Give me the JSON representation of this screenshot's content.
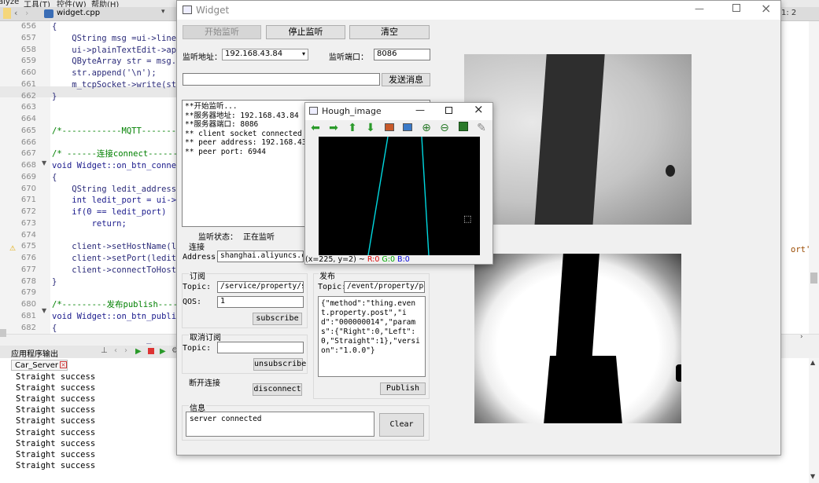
{
  "ide": {
    "menu": [
      "alyze",
      "工具(T)",
      "控件(W)",
      "帮助(H)"
    ],
    "tab_filename": "widget.cpp",
    "cursor_pos": "1: 2",
    "right_code_fragment": "ort')",
    "lines": [
      {
        "num": "656",
        "code": "{"
      },
      {
        "num": "657",
        "code": "    QString msg =ui->line"
      },
      {
        "num": "658",
        "code": "    ui->plainTextEdit->ap"
      },
      {
        "num": "659",
        "code": "    QByteArray str = msg."
      },
      {
        "num": "660",
        "code": "    str.append('\\n');"
      },
      {
        "num": "661",
        "code": "    m_tcpSocket->write(st"
      },
      {
        "num": "662",
        "code": "}"
      },
      {
        "num": "663",
        "code": ""
      },
      {
        "num": "664",
        "code": ""
      },
      {
        "num": "665",
        "code": "/*------------MQTT--------"
      },
      {
        "num": "666",
        "code": ""
      },
      {
        "num": "667",
        "code": "/* ------连接connect------"
      },
      {
        "num": "668",
        "code": "void Widget::on_btn_conne"
      },
      {
        "num": "669",
        "code": "{"
      },
      {
        "num": "670",
        "code": "    QString ledit_address"
      },
      {
        "num": "671",
        "code": "    int ledit_port = ui->"
      },
      {
        "num": "672",
        "code": "    if(0 == ledit_port)"
      },
      {
        "num": "673",
        "code": "        return;"
      },
      {
        "num": "674",
        "code": ""
      },
      {
        "num": "675",
        "code": "    client->setHostName(l"
      },
      {
        "num": "676",
        "code": "    client->setPort(ledit"
      },
      {
        "num": "677",
        "code": "    client->connectToHost"
      },
      {
        "num": "678",
        "code": "}"
      },
      {
        "num": "679",
        "code": ""
      },
      {
        "num": "680",
        "code": "/*---------发布publish----"
      },
      {
        "num": "681",
        "code": "void Widget::on_btn_publi"
      },
      {
        "num": "682",
        "code": "{"
      },
      {
        "num": "683",
        "code": "    // QByteArray m_paylo"
      }
    ],
    "output_title": "应用程序输出",
    "output_tab": "Car_Server",
    "output_lines": [
      "Straight success",
      "Straight success",
      "Straight success",
      "Straight success",
      "Straight success",
      "Straight success",
      "Straight success",
      "Straight success",
      "Straight success"
    ]
  },
  "widget": {
    "title": "Widget",
    "btn_start": "开始监听",
    "btn_stop": "停止监听",
    "btn_clear_top": "清空",
    "listen_addr_label": "监听地址：",
    "listen_addr_value": "192.168.43.84",
    "listen_port_label": "监听端口：",
    "listen_port_value": "8086",
    "send_input": "",
    "btn_send": "发送消息",
    "log_lines": [
      "**开始监听...",
      "**服务器地址: 192.168.43.84",
      "**服务器端口: 8086",
      "** client socket connected",
      "** peer address: 192.168.43.16",
      "** peer port: 6944"
    ],
    "status_label": "监听状态：",
    "status_value": "正在监听",
    "connect_group": "连接",
    "address_label": "Address:",
    "address_value": "shanghai.aliyuncs.com",
    "subscribe_group": "订阅",
    "topic_label": "Topic:",
    "sub_topic_value": "/service/property/set",
    "qos_label": "QOS:",
    "qos_value": "1",
    "btn_subscribe": "subscribe",
    "unsub_group": "取消订阅",
    "unsub_topic_value": "",
    "btn_unsubscribe": "unsubscribe",
    "disconnect_group": "断开连接",
    "btn_disconnect": "disconnect",
    "publish_group": "发布",
    "pub_topic_value": "/event/property/post",
    "pub_payload": "{\"method\":\"thing.event.property.post\",\"id\":\"000000014\",\"params\":{\"Right\":0,\"Left\":0,\"Straight\":1},\"version\":\"1.0.0\"}",
    "btn_publish": "Publish",
    "info_group": "信息",
    "info_text": "server connected",
    "btn_clear": "Clear"
  },
  "hough": {
    "title": "Hough_image",
    "toolbar_icons": [
      "arrow-left-icon",
      "arrow-right-icon",
      "arrow-up-icon",
      "arrow-down-icon",
      "image-icon",
      "image-save-icon",
      "zoom-in-icon",
      "zoom-out-icon",
      "save-icon",
      "brush-icon"
    ],
    "status_coords": "(x=225, y=2) ~",
    "status_r": "R:0",
    "status_g": "G:0",
    "status_b": "B:0"
  }
}
